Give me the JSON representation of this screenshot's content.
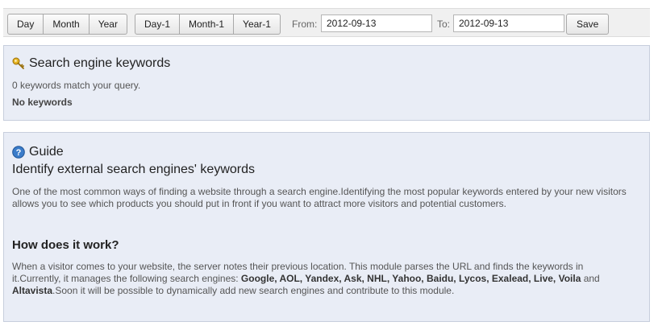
{
  "toolbar": {
    "period_buttons": [
      "Day",
      "Month",
      "Year"
    ],
    "relative_buttons": [
      "Day-1",
      "Month-1",
      "Year-1"
    ],
    "from_label": "From:",
    "from_value": "2012-09-13",
    "to_label": "To:",
    "to_value": "2012-09-13",
    "save_label": "Save"
  },
  "keywords_panel": {
    "title": "Search engine keywords",
    "icon": "key-icon",
    "match_text": "0 keywords match your query.",
    "empty_text": "No keywords"
  },
  "guide_panel": {
    "title": "Guide",
    "icon": "help-icon",
    "subtitle": "Identify external search engines' keywords",
    "intro_line1": "One of the most common ways of finding a website through a search engine.Identifying the most popular keywords entered by your new visitors",
    "intro_line2": "allows you to see which products you should put in front if you want to attract more visitors and potential customers.",
    "how_title": "How does it work?",
    "how_line1": "When a visitor comes to your website, the server notes their previous location. This module parses the URL and finds the keywords in",
    "how_line2_prefix": "it.Currently, it manages the following search engines: ",
    "engines": "Google, AOL, Yandex, Ask, NHL, Yahoo, Baidu, Lycos, Exalead, Live, Voila",
    "how_line2_and": " and",
    "engine_last": "Altavista",
    "how_line3_suffix": ".Soon it will be possible to dynamically add new search engines and contribute to this module."
  }
}
